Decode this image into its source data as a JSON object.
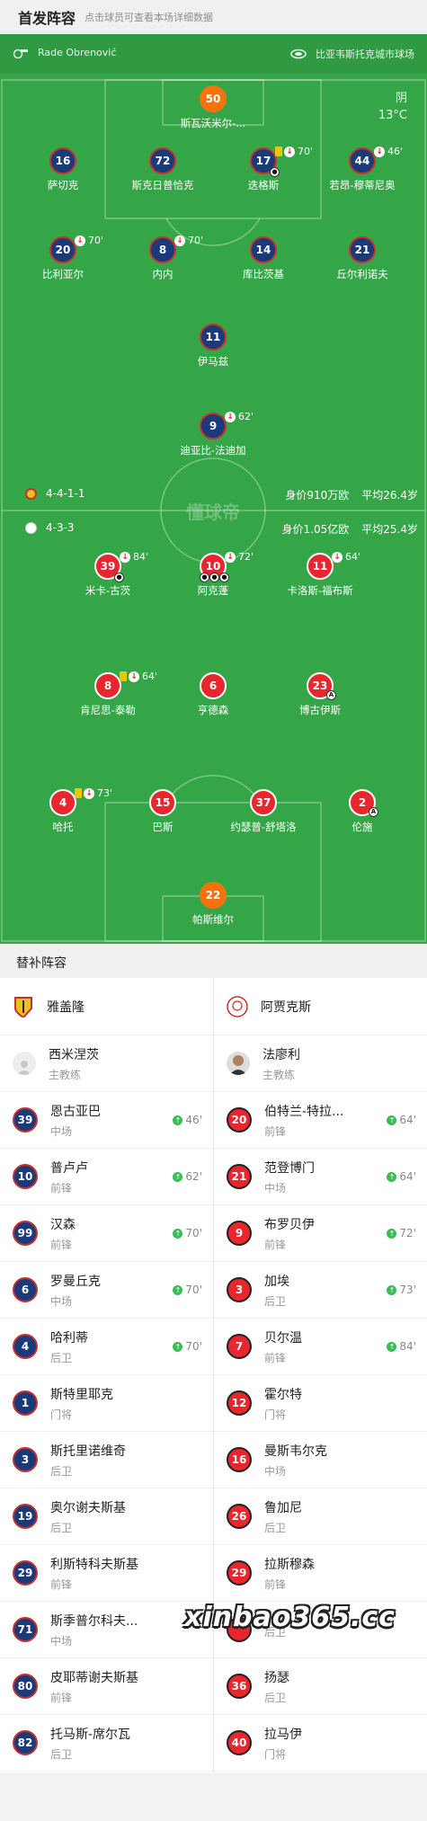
{
  "header": {
    "title": "首发阵容",
    "subtitle": "点击球员可查看本场详细数据"
  },
  "match": {
    "referee": "Rade Obrenović",
    "venue": "比亚韦斯托克城市球场",
    "weather": "阴",
    "temperature": "13°C"
  },
  "home": {
    "name": "雅盖隆",
    "formation": "4-4-1-1",
    "value": "身价910万欧",
    "avg_age": "平均26.4岁",
    "players": [
      {
        "num": "50",
        "name": "斯瓦沃米尔-...",
        "gk": true
      },
      {
        "num": "16",
        "name": "萨切克"
      },
      {
        "num": "72",
        "name": "斯克日普恰克"
      },
      {
        "num": "17",
        "name": "迭格斯",
        "sub": "70'",
        "yellow": true,
        "goal": true
      },
      {
        "num": "44",
        "name": "若昂-穆蒂尼奥",
        "sub": "46'"
      },
      {
        "num": "20",
        "name": "比利亚尔",
        "sub": "70'"
      },
      {
        "num": "8",
        "name": "内内",
        "sub": "70'"
      },
      {
        "num": "14",
        "name": "库比茨基"
      },
      {
        "num": "21",
        "name": "丘尔利诺夫"
      },
      {
        "num": "11",
        "name": "伊马兹"
      },
      {
        "num": "9",
        "name": "迪亚比-法迪加",
        "sub": "62'"
      }
    ]
  },
  "away": {
    "name": "阿贾克斯",
    "formation": "4-3-3",
    "value": "身价1.05亿欧",
    "avg_age": "平均25.4岁",
    "players": [
      {
        "num": "39",
        "name": "米卡-古茨",
        "sub": "84'",
        "goals": 1
      },
      {
        "num": "10",
        "name": "阿克蓬",
        "sub": "72'",
        "goals": 3
      },
      {
        "num": "11",
        "name": "卡洛斯-福布斯",
        "sub": "64'"
      },
      {
        "num": "8",
        "name": "肯尼思-泰勒",
        "sub": "64'",
        "yellow": true
      },
      {
        "num": "6",
        "name": "亨德森"
      },
      {
        "num": "23",
        "name": "博古伊斯",
        "assist": true
      },
      {
        "num": "4",
        "name": "哈托",
        "sub": "73'",
        "yellow": true
      },
      {
        "num": "15",
        "name": "巴斯"
      },
      {
        "num": "37",
        "name": "约瑟普-舒塔洛"
      },
      {
        "num": "2",
        "name": "伦施",
        "assist": true
      },
      {
        "num": "22",
        "name": "帕斯维尔",
        "gk": true
      }
    ]
  },
  "watermark": "懂球帝",
  "bench": {
    "title": "替补阵容",
    "home_coach": {
      "name": "西米涅茨",
      "role": "主教练"
    },
    "away_coach": {
      "name": "法廖利",
      "role": "主教练"
    },
    "home_subs": [
      {
        "num": "39",
        "name": "恩古亚巴",
        "pos": "中场",
        "on": "46'"
      },
      {
        "num": "10",
        "name": "普卢卢",
        "pos": "前锋",
        "on": "62'"
      },
      {
        "num": "99",
        "name": "汉森",
        "pos": "前锋",
        "on": "70'"
      },
      {
        "num": "6",
        "name": "罗曼丘克",
        "pos": "中场",
        "on": "70'"
      },
      {
        "num": "4",
        "name": "哈利蒂",
        "pos": "后卫",
        "on": "70'"
      },
      {
        "num": "1",
        "name": "斯特里耶克",
        "pos": "门将"
      },
      {
        "num": "3",
        "name": "斯托里诺维奇",
        "pos": "后卫"
      },
      {
        "num": "19",
        "name": "奥尔谢夫斯基",
        "pos": "后卫"
      },
      {
        "num": "29",
        "name": "利斯特科夫斯基",
        "pos": "前锋"
      },
      {
        "num": "71",
        "name": "斯季普尔科夫...",
        "pos": "中场"
      },
      {
        "num": "80",
        "name": "皮耶蒂谢夫斯基",
        "pos": "前锋"
      },
      {
        "num": "82",
        "name": "托马斯-席尔瓦",
        "pos": "后卫"
      }
    ],
    "away_subs": [
      {
        "num": "20",
        "name": "伯特兰-特拉...",
        "pos": "前锋",
        "on": "64'"
      },
      {
        "num": "21",
        "name": "范登博门",
        "pos": "中场",
        "on": "64'"
      },
      {
        "num": "9",
        "name": "布罗贝伊",
        "pos": "前锋",
        "on": "72'"
      },
      {
        "num": "3",
        "name": "加埃",
        "pos": "后卫",
        "on": "73'"
      },
      {
        "num": "7",
        "name": "贝尔温",
        "pos": "前锋",
        "on": "84'"
      },
      {
        "num": "12",
        "name": "霍尔特",
        "pos": "门将"
      },
      {
        "num": "16",
        "name": "曼斯韦尔克",
        "pos": "中场"
      },
      {
        "num": "26",
        "name": "鲁加尼",
        "pos": "后卫"
      },
      {
        "num": "29",
        "name": "拉斯穆森",
        "pos": "前锋"
      },
      {
        "num": "",
        "name": "",
        "pos": "后卫"
      },
      {
        "num": "36",
        "name": "扬瑟",
        "pos": "后卫"
      },
      {
        "num": "40",
        "name": "拉马伊",
        "pos": "门将"
      }
    ]
  },
  "site_watermark": "xinbao365.cc",
  "colors": {
    "pitch": "#35a648",
    "home": "#1a3a7a",
    "away": "#e8262d",
    "gk": "#f5730f"
  }
}
